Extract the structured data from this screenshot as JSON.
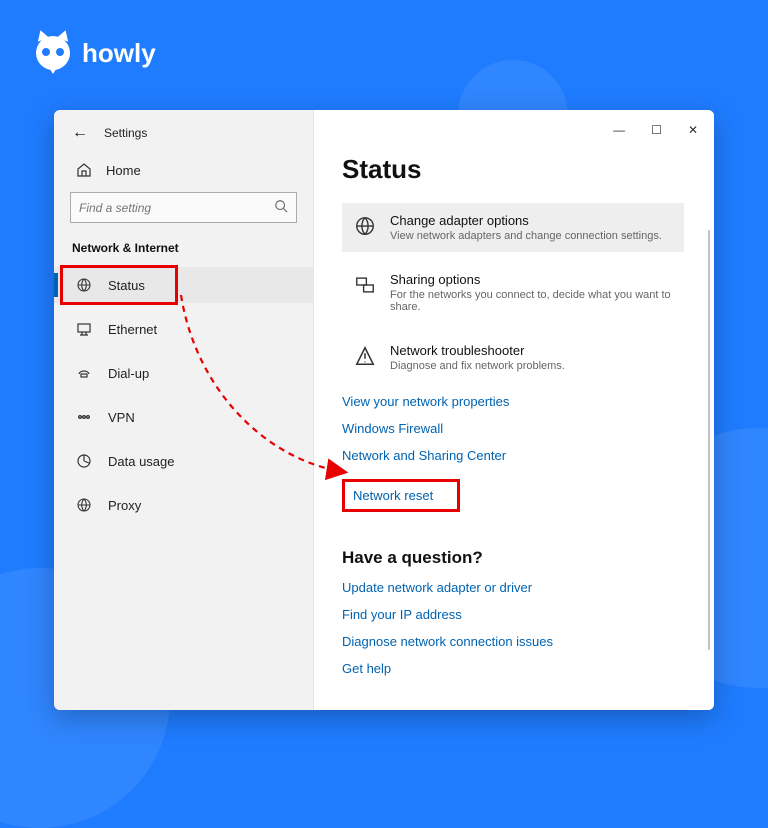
{
  "brand": {
    "name": "howly"
  },
  "window": {
    "title": "Settings",
    "controls": {
      "minimize": "—",
      "maximize": "☐",
      "close": "✕"
    }
  },
  "sidebar": {
    "back_icon": "←",
    "home": {
      "label": "Home"
    },
    "search": {
      "placeholder": "Find a setting"
    },
    "section": "Network & Internet",
    "items": [
      {
        "key": "status",
        "label": "Status",
        "selected": true
      },
      {
        "key": "ethernet",
        "label": "Ethernet"
      },
      {
        "key": "dialup",
        "label": "Dial-up"
      },
      {
        "key": "vpn",
        "label": "VPN"
      },
      {
        "key": "datausage",
        "label": "Data usage"
      },
      {
        "key": "proxy",
        "label": "Proxy"
      }
    ]
  },
  "main": {
    "title": "Status",
    "options": [
      {
        "id": "adapter",
        "title": "Change adapter options",
        "sub": "View network adapters and change connection settings."
      },
      {
        "id": "sharing",
        "title": "Sharing options",
        "sub": "For the networks you connect to, decide what you want to share."
      },
      {
        "id": "troubleshoot",
        "title": "Network troubleshooter",
        "sub": "Diagnose and fix network problems."
      }
    ],
    "links": [
      "View your network properties",
      "Windows Firewall",
      "Network and Sharing Center",
      "Network reset"
    ],
    "question_heading": "Have a question?",
    "help_links": [
      "Update network adapter or driver",
      "Find your IP address",
      "Diagnose network connection issues",
      "Get help"
    ]
  },
  "annotations": {
    "highlight_status": true,
    "highlight_network_reset": true
  }
}
